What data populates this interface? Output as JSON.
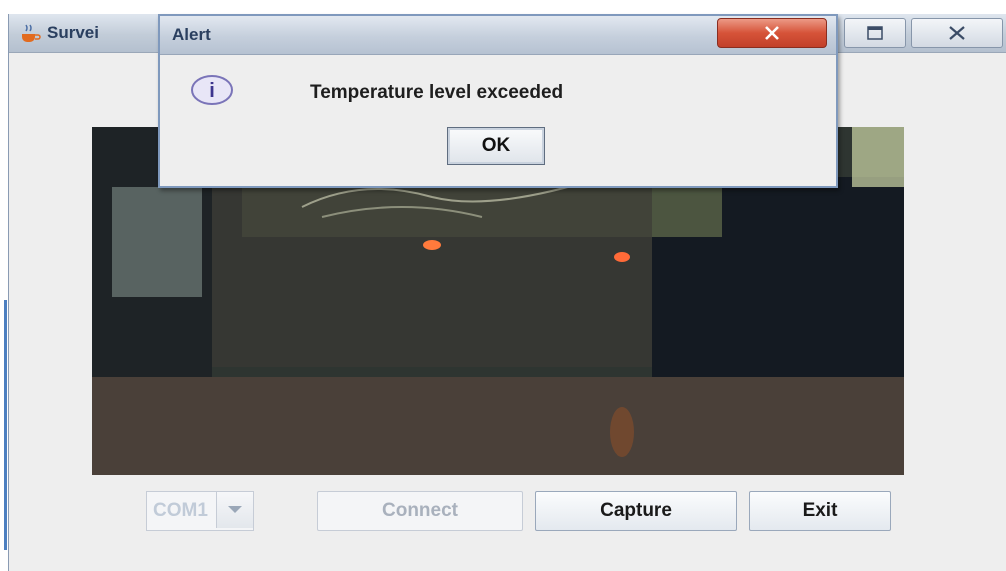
{
  "main_window": {
    "title": "Survei",
    "icon": "java-cup-icon"
  },
  "alert": {
    "title": "Alert",
    "icon": "info-icon",
    "icon_glyph": "i",
    "message": "Temperature level exceeded",
    "ok_label": "OK"
  },
  "controls": {
    "port_value": "COM1",
    "connect_label": "Connect",
    "capture_label": "Capture",
    "exit_label": "Exit"
  },
  "colors": {
    "close_button": "#d65339",
    "accent": "#4d7fc0"
  }
}
